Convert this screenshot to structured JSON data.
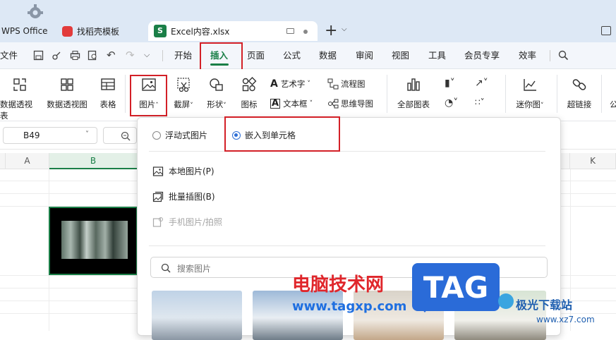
{
  "titlebar": {
    "tabs": [
      {
        "label": "WPS Office"
      },
      {
        "label": "找稻壳模板"
      },
      {
        "label": "Excel内容.xlsx"
      }
    ],
    "new_tab_symbol": "+"
  },
  "menubar": {
    "file_label": "文件",
    "items": [
      "开始",
      "插入",
      "页面",
      "公式",
      "数据",
      "审阅",
      "视图",
      "工具",
      "会员专享",
      "效率"
    ],
    "selected": "插入"
  },
  "ribbon": {
    "pivot_table": "数据透视表",
    "pivot_chart": "数据透视图",
    "table": "表格",
    "picture": "图片",
    "screenshot": "截屏",
    "shapes": "形状",
    "icons": "图标",
    "wordart": "艺术字",
    "textbox": "文本框",
    "flowchart": "流程图",
    "mindmap": "思维导图",
    "all_charts": "全部图表",
    "sparkline": "迷你图",
    "hyperlink": "超链接",
    "formula_partial": "公"
  },
  "formula_bar": {
    "name_box": "B49"
  },
  "grid": {
    "columns": [
      "A",
      "B",
      "K"
    ]
  },
  "dropdown": {
    "mode_options": [
      "浮动式图片",
      "嵌入到单元格"
    ],
    "selected_mode": "嵌入到单元格",
    "local_picture": "本地图片(P)",
    "batch_insert": "批量插图(B)",
    "phone_picture": "手机图片/拍照",
    "search_placeholder": "搜索图片"
  },
  "watermark": {
    "site_name": "电脑技术网",
    "site_url": "www.tagxp.com",
    "logo_text": "TAG",
    "corner_brand": "极光下载站",
    "corner_url": "www.xz7.com"
  },
  "colors": {
    "accent_green": "#1a7f47",
    "highlight_red": "#d32027",
    "titlebar_bg": "#dde8f5",
    "watermark_blue": "#1f6fe0"
  }
}
